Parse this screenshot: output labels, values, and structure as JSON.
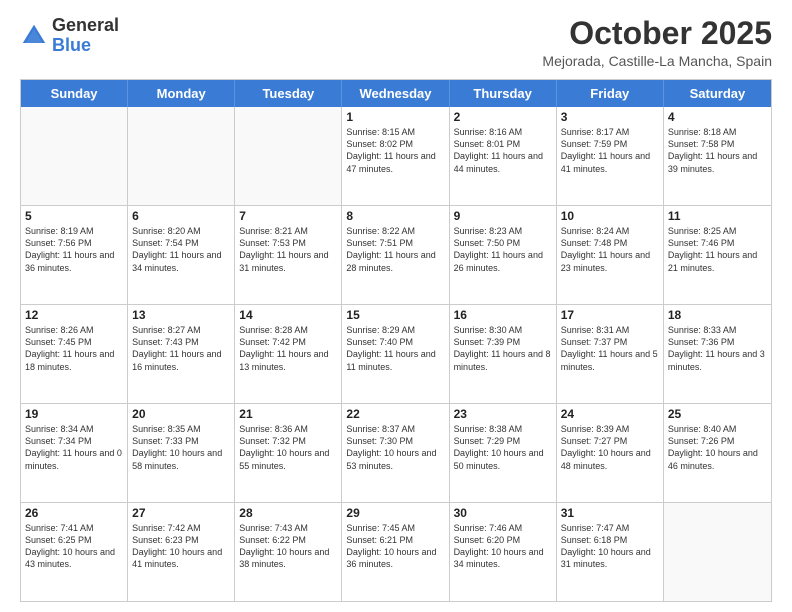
{
  "header": {
    "logo": {
      "general": "General",
      "blue": "Blue"
    },
    "title": "October 2025",
    "location": "Mejorada, Castille-La Mancha, Spain"
  },
  "calendar": {
    "days": [
      "Sunday",
      "Monday",
      "Tuesday",
      "Wednesday",
      "Thursday",
      "Friday",
      "Saturday"
    ],
    "rows": [
      [
        {
          "day": "",
          "empty": true
        },
        {
          "day": "",
          "empty": true
        },
        {
          "day": "",
          "empty": true
        },
        {
          "day": "1",
          "sunrise": "8:15 AM",
          "sunset": "8:02 PM",
          "daylight": "11 hours and 47 minutes."
        },
        {
          "day": "2",
          "sunrise": "8:16 AM",
          "sunset": "8:01 PM",
          "daylight": "11 hours and 44 minutes."
        },
        {
          "day": "3",
          "sunrise": "8:17 AM",
          "sunset": "7:59 PM",
          "daylight": "11 hours and 41 minutes."
        },
        {
          "day": "4",
          "sunrise": "8:18 AM",
          "sunset": "7:58 PM",
          "daylight": "11 hours and 39 minutes."
        }
      ],
      [
        {
          "day": "5",
          "sunrise": "8:19 AM",
          "sunset": "7:56 PM",
          "daylight": "11 hours and 36 minutes."
        },
        {
          "day": "6",
          "sunrise": "8:20 AM",
          "sunset": "7:54 PM",
          "daylight": "11 hours and 34 minutes."
        },
        {
          "day": "7",
          "sunrise": "8:21 AM",
          "sunset": "7:53 PM",
          "daylight": "11 hours and 31 minutes."
        },
        {
          "day": "8",
          "sunrise": "8:22 AM",
          "sunset": "7:51 PM",
          "daylight": "11 hours and 28 minutes."
        },
        {
          "day": "9",
          "sunrise": "8:23 AM",
          "sunset": "7:50 PM",
          "daylight": "11 hours and 26 minutes."
        },
        {
          "day": "10",
          "sunrise": "8:24 AM",
          "sunset": "7:48 PM",
          "daylight": "11 hours and 23 minutes."
        },
        {
          "day": "11",
          "sunrise": "8:25 AM",
          "sunset": "7:46 PM",
          "daylight": "11 hours and 21 minutes."
        }
      ],
      [
        {
          "day": "12",
          "sunrise": "8:26 AM",
          "sunset": "7:45 PM",
          "daylight": "11 hours and 18 minutes."
        },
        {
          "day": "13",
          "sunrise": "8:27 AM",
          "sunset": "7:43 PM",
          "daylight": "11 hours and 16 minutes."
        },
        {
          "day": "14",
          "sunrise": "8:28 AM",
          "sunset": "7:42 PM",
          "daylight": "11 hours and 13 minutes."
        },
        {
          "day": "15",
          "sunrise": "8:29 AM",
          "sunset": "7:40 PM",
          "daylight": "11 hours and 11 minutes."
        },
        {
          "day": "16",
          "sunrise": "8:30 AM",
          "sunset": "7:39 PM",
          "daylight": "11 hours and 8 minutes."
        },
        {
          "day": "17",
          "sunrise": "8:31 AM",
          "sunset": "7:37 PM",
          "daylight": "11 hours and 5 minutes."
        },
        {
          "day": "18",
          "sunrise": "8:33 AM",
          "sunset": "7:36 PM",
          "daylight": "11 hours and 3 minutes."
        }
      ],
      [
        {
          "day": "19",
          "sunrise": "8:34 AM",
          "sunset": "7:34 PM",
          "daylight": "11 hours and 0 minutes."
        },
        {
          "day": "20",
          "sunrise": "8:35 AM",
          "sunset": "7:33 PM",
          "daylight": "10 hours and 58 minutes."
        },
        {
          "day": "21",
          "sunrise": "8:36 AM",
          "sunset": "7:32 PM",
          "daylight": "10 hours and 55 minutes."
        },
        {
          "day": "22",
          "sunrise": "8:37 AM",
          "sunset": "7:30 PM",
          "daylight": "10 hours and 53 minutes."
        },
        {
          "day": "23",
          "sunrise": "8:38 AM",
          "sunset": "7:29 PM",
          "daylight": "10 hours and 50 minutes."
        },
        {
          "day": "24",
          "sunrise": "8:39 AM",
          "sunset": "7:27 PM",
          "daylight": "10 hours and 48 minutes."
        },
        {
          "day": "25",
          "sunrise": "8:40 AM",
          "sunset": "7:26 PM",
          "daylight": "10 hours and 46 minutes."
        }
      ],
      [
        {
          "day": "26",
          "sunrise": "7:41 AM",
          "sunset": "6:25 PM",
          "daylight": "10 hours and 43 minutes."
        },
        {
          "day": "27",
          "sunrise": "7:42 AM",
          "sunset": "6:23 PM",
          "daylight": "10 hours and 41 minutes."
        },
        {
          "day": "28",
          "sunrise": "7:43 AM",
          "sunset": "6:22 PM",
          "daylight": "10 hours and 38 minutes."
        },
        {
          "day": "29",
          "sunrise": "7:45 AM",
          "sunset": "6:21 PM",
          "daylight": "10 hours and 36 minutes."
        },
        {
          "day": "30",
          "sunrise": "7:46 AM",
          "sunset": "6:20 PM",
          "daylight": "10 hours and 34 minutes."
        },
        {
          "day": "31",
          "sunrise": "7:47 AM",
          "sunset": "6:18 PM",
          "daylight": "10 hours and 31 minutes."
        },
        {
          "day": "",
          "empty": true
        }
      ]
    ]
  }
}
